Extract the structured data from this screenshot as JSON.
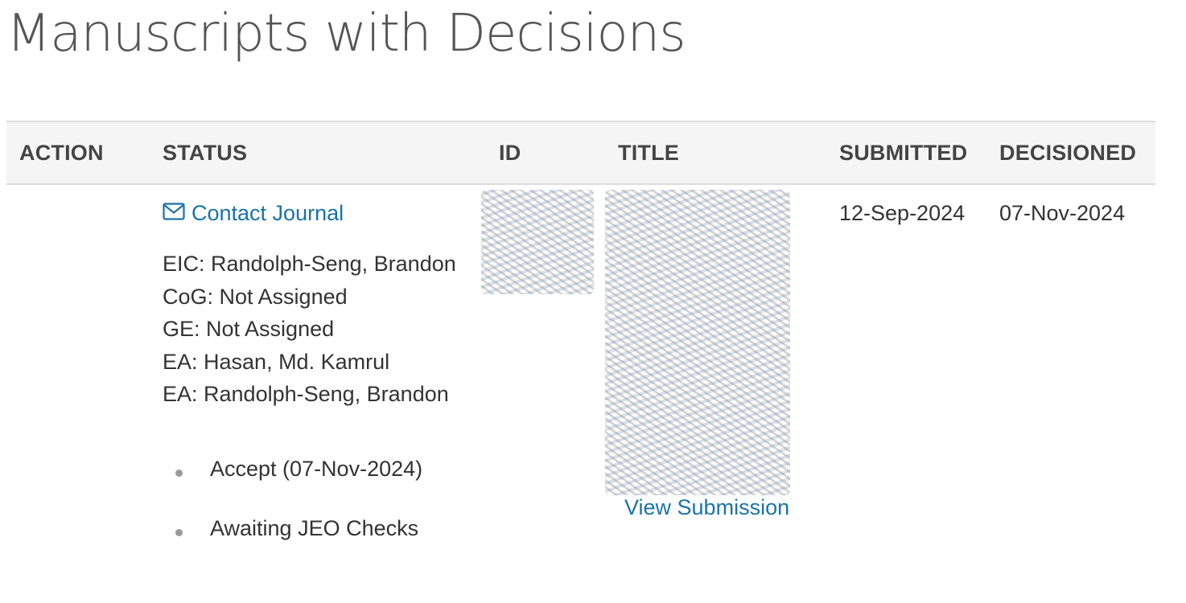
{
  "page": {
    "title": "Manuscripts with Decisions"
  },
  "table": {
    "headers": {
      "action": "ACTION",
      "status": "STATUS",
      "id": "ID",
      "title": "TITLE",
      "submitted": "SUBMITTED",
      "decisioned": "DECISIONED"
    },
    "row": {
      "contact_label": "Contact Journal",
      "assignments": [
        "EIC: Randolph-Seng, Brandon",
        "CoG: Not Assigned",
        "GE: Not Assigned",
        "EA: Hasan, Md. Kamrul",
        "EA: Randolph-Seng, Brandon"
      ],
      "status_items": [
        "Accept (07-Nov-2024)",
        "Awaiting JEO Checks"
      ],
      "view_submission_label": "View Submission",
      "submitted": "12-Sep-2024",
      "decisioned": "07-Nov-2024"
    }
  },
  "colors": {
    "link": "#1a73a8",
    "header_bg": "#f5f5f5",
    "text": "#333333"
  },
  "icons": {
    "contact": "envelope-icon"
  }
}
